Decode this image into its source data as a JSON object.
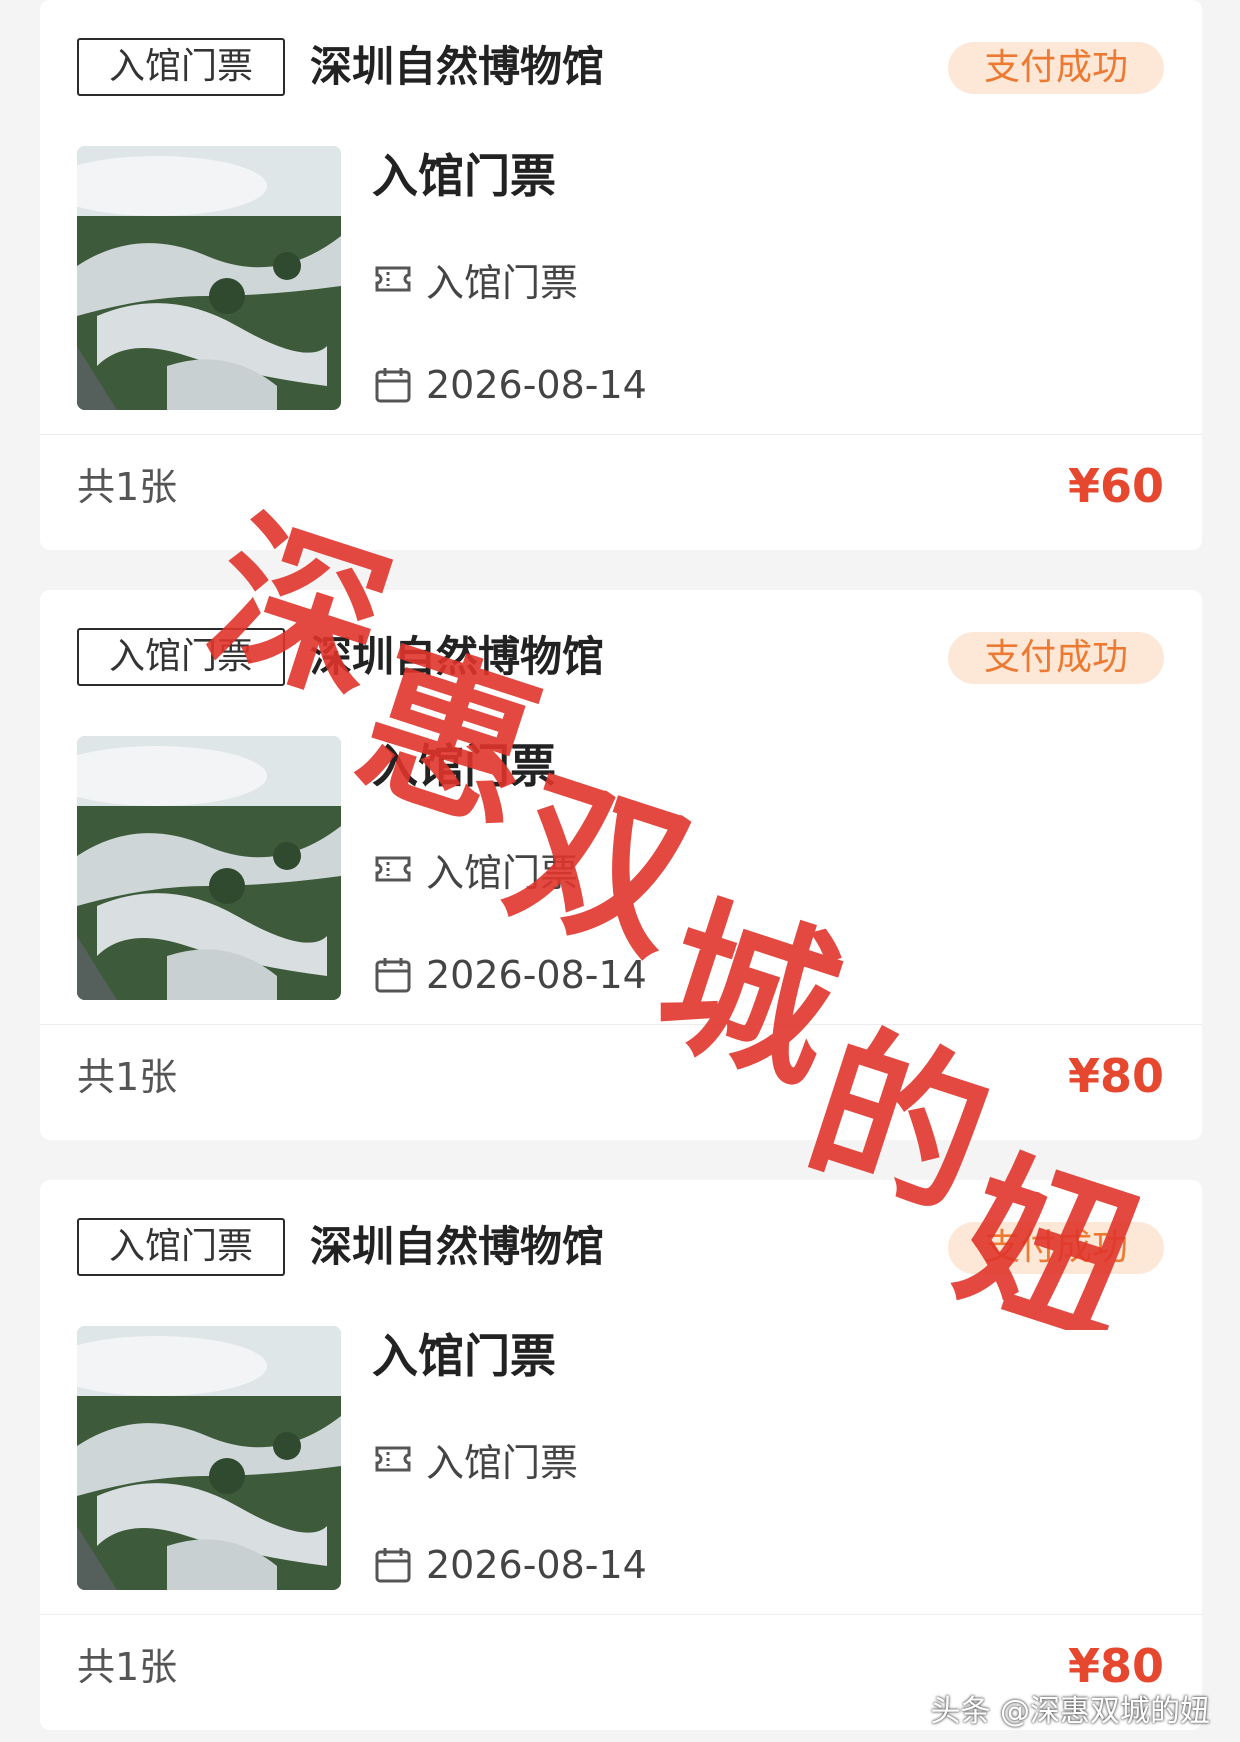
{
  "orders": [
    {
      "type_tag": "入馆门票",
      "venue": "深圳自然博物馆",
      "status": "支付成功",
      "ticket_title": "入馆门票",
      "ticket_type": "入馆门票",
      "date": "2026-08-14",
      "count": "共1张",
      "price": "¥60"
    },
    {
      "type_tag": "入馆门票",
      "venue": "深圳自然博物馆",
      "status": "支付成功",
      "ticket_title": "入馆门票",
      "ticket_type": "入馆门票",
      "date": "2026-08-14",
      "count": "共1张",
      "price": "¥80"
    },
    {
      "type_tag": "入馆门票",
      "venue": "深圳自然博物馆",
      "status": "支付成功",
      "ticket_title": "入馆门票",
      "ticket_type": "入馆门票",
      "date": "2026-08-14",
      "count": "共1张",
      "price": "¥80"
    }
  ],
  "overlay_stamp": "深惠双城的妞",
  "watermark": "头条 @深惠双城的妞",
  "colors": {
    "status_text": "#ec7a32",
    "status_bg": "#fde8d8",
    "price": "#e5482e",
    "stamp": "#e0352b"
  }
}
